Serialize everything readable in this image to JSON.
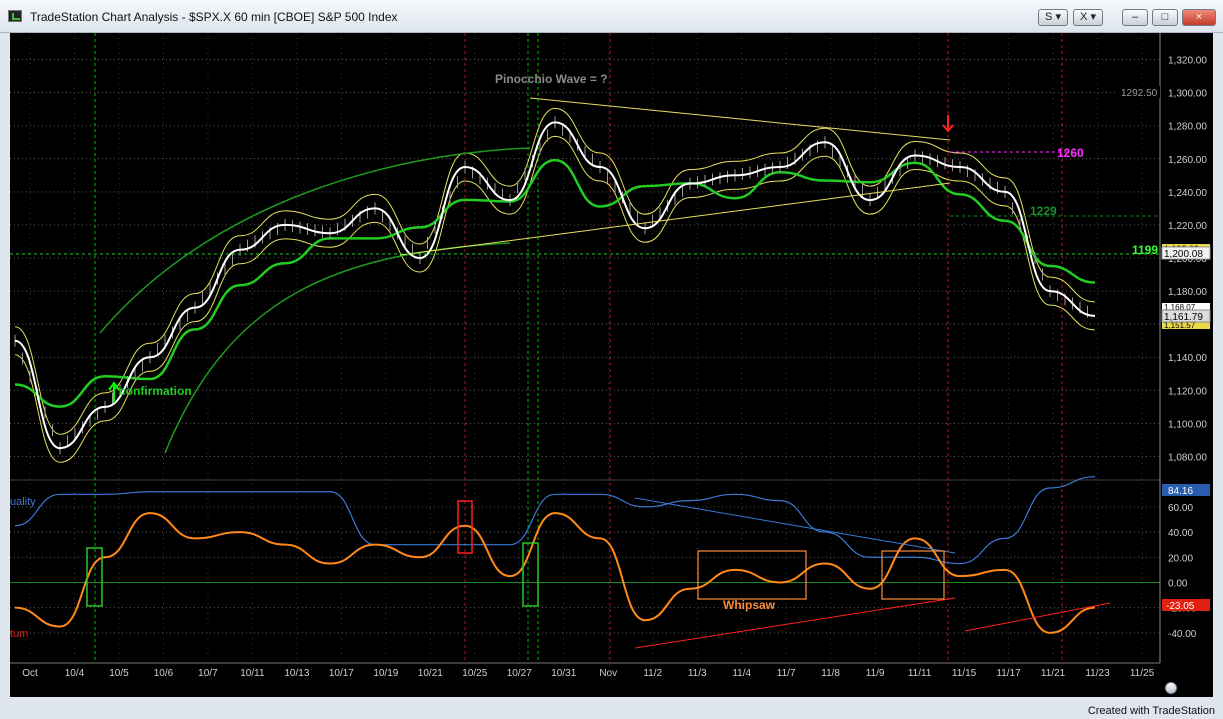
{
  "window": {
    "title": "TradeStation Chart Analysis - $SPX.X 60 min [CBOE] S&P 500 Index",
    "controls": {
      "s_label": "S",
      "x_label": "X",
      "minimize": "–",
      "restore": "□",
      "close": "×"
    }
  },
  "footer": {
    "created_by": "Created with TradeStation"
  },
  "colors": {
    "background": "#000000",
    "grid": "#5a5a5a",
    "price_axis_text": "#cfcfcf",
    "green_marker": "#00ff00",
    "red_marker": "#ff2020",
    "yellow_line": "#e8e060",
    "blue_line": "#3a7ad8",
    "magenta": "#ff30ff"
  },
  "price_axis": {
    "ticks": [
      "1,320.00",
      "1,300.00",
      "1,280.00",
      "1,260.00",
      "1,240.00",
      "1,220.00",
      "1,200.00",
      "1,180.00",
      "1,160.00",
      "1,140.00",
      "1,120.00",
      "1,100.00",
      "1,080.00"
    ]
  },
  "indicator_axis": {
    "ticks": [
      "60.00",
      "40.00",
      "20.00",
      "0.00",
      "-20.00",
      "-40.00"
    ]
  },
  "date_axis": {
    "labels": [
      "Oct",
      "10/4",
      "10/5",
      "10/6",
      "10/7",
      "10/11",
      "10/13",
      "10/17",
      "10/19",
      "10/21",
      "10/25",
      "10/27",
      "10/31",
      "Nov",
      "11/2",
      "11/3",
      "11/4",
      "11/7",
      "11/8",
      "11/9",
      "11/11",
      "11/15",
      "11/17",
      "11/21",
      "11/23",
      "11/25"
    ]
  },
  "price_badges": {
    "top": "1292.50",
    "level1": "1,200.08",
    "level1b": "1,198.09",
    "last": "1,161.79",
    "last_b": "1,168.07",
    "last_c": "1,151.57"
  },
  "indicator_badges": {
    "quality": "84.16",
    "momentum": "-23.05"
  },
  "annotations": {
    "wave": "Pinocchio Wave = ?",
    "confirmation": "confirmation",
    "level_1260": "1260",
    "level_1229": "1229",
    "level_1199": "1199",
    "whipsaw": "Whipsaw",
    "quality_label": "uality",
    "momentum_label": "tum"
  },
  "chart_data": {
    "type": "line",
    "title": "",
    "xlabel": "",
    "ylabel": "",
    "x": [
      "Oct",
      "10/4",
      "10/5",
      "10/6",
      "10/7",
      "10/11",
      "10/13",
      "10/17",
      "10/19",
      "10/21",
      "10/25",
      "10/27",
      "10/31",
      "Nov",
      "11/2",
      "11/3",
      "11/4",
      "11/7",
      "11/8",
      "11/9",
      "11/11",
      "11/15",
      "11/17",
      "11/21",
      "11/23"
    ],
    "ylim": [
      1070,
      1330
    ],
    "series": [
      {
        "values": [
          1150,
          1085,
          1110,
          1140,
          1170,
          1205,
          1220,
          1215,
          1230,
          1200,
          1255,
          1235,
          1282,
          1255,
          1218,
          1245,
          1250,
          1255,
          1270,
          1235,
          1262,
          1255,
          1240,
          1180,
          1165
        ]
      }
    ],
    "indicator": {
      "ylim": [
        -60,
        75
      ],
      "momentum": [
        -20,
        -35,
        20,
        55,
        35,
        40,
        30,
        15,
        30,
        20,
        45,
        5,
        55,
        35,
        -30,
        -5,
        10,
        0,
        15,
        -5,
        35,
        5,
        10,
        -40,
        -20
      ],
      "quality": [
        45,
        70,
        70,
        72,
        72,
        72,
        72,
        72,
        30,
        30,
        30,
        30,
        70,
        70,
        60,
        65,
        70,
        65,
        40,
        20,
        20,
        15,
        35,
        75,
        84
      ]
    }
  }
}
